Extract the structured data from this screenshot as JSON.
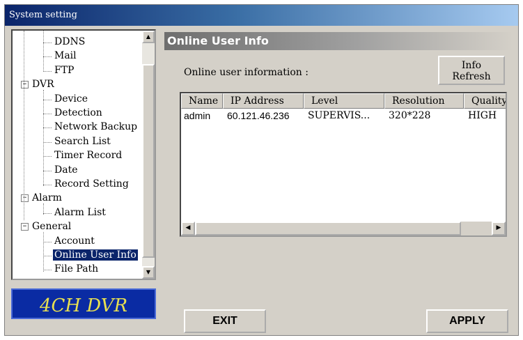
{
  "window": {
    "title": "System setting"
  },
  "tree": {
    "items": [
      {
        "label": "DDNS",
        "level": 2
      },
      {
        "label": "Mail",
        "level": 2
      },
      {
        "label": "FTP",
        "level": 2
      },
      {
        "label": "DVR",
        "level": 1,
        "expander": "−"
      },
      {
        "label": "Device",
        "level": 2
      },
      {
        "label": "Detection",
        "level": 2
      },
      {
        "label": "Network Backup",
        "level": 2
      },
      {
        "label": "Search List",
        "level": 2
      },
      {
        "label": "Timer Record",
        "level": 2
      },
      {
        "label": "Date",
        "level": 2
      },
      {
        "label": "Record Setting",
        "level": 2
      },
      {
        "label": "Alarm",
        "level": 1,
        "expander": "−"
      },
      {
        "label": "Alarm List",
        "level": 2
      },
      {
        "label": "General",
        "level": 1,
        "expander": "−"
      },
      {
        "label": "Account",
        "level": 2
      },
      {
        "label": "Online User Info",
        "level": 2,
        "selected": true
      },
      {
        "label": "File Path",
        "level": 2
      }
    ],
    "scroll_up": "▲",
    "scroll_down": "▼"
  },
  "logo": {
    "text": "4CH DVR"
  },
  "panel": {
    "title": "Online User Info",
    "info_label": "Online user information :",
    "refresh_button": "Info\nRefresh"
  },
  "table": {
    "columns": [
      "Name",
      "IP Address",
      "Level",
      "Resolution",
      "Quality"
    ],
    "rows": [
      [
        "admin",
        "60.121.46.236",
        "SUPERVIS...",
        "320*228",
        "HIGH"
      ]
    ],
    "scroll_left": "◀",
    "scroll_right": "▶"
  },
  "buttons": {
    "exit": "EXIT",
    "apply": "APPLY"
  },
  "colors": {
    "selection": "#0a246a",
    "logo_bg": "#0a2ba3",
    "logo_text": "#e8e050",
    "face": "#d4d0c8"
  }
}
